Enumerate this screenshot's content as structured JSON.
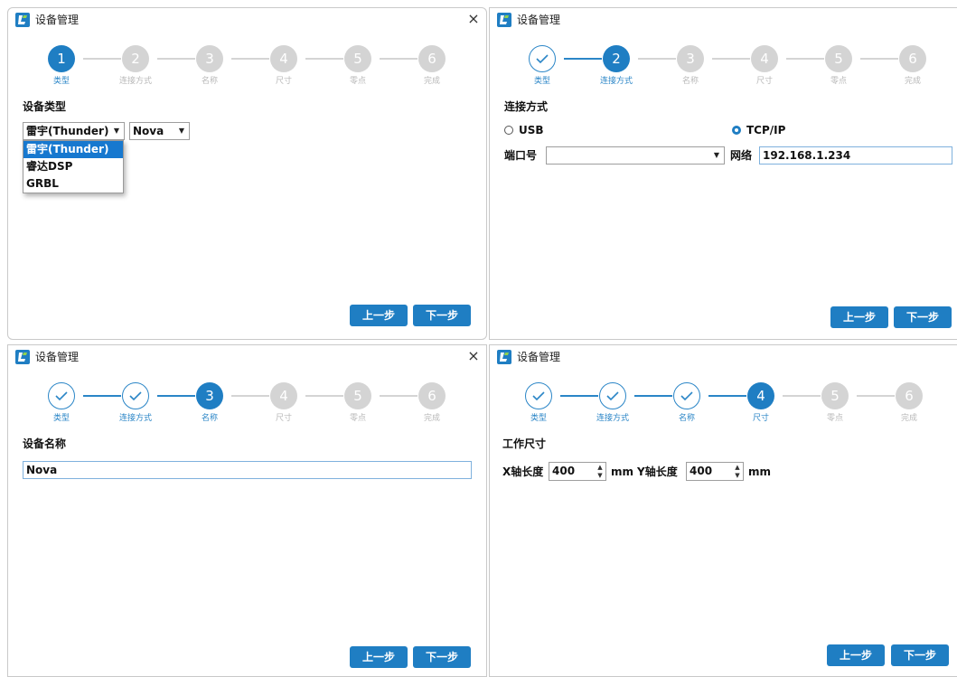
{
  "window": {
    "title": "设备管理",
    "close": "×",
    "app_icon": "app-logo-icon",
    "close_icon": "close-icon"
  },
  "steps": [
    {
      "num": "1",
      "label": "类型"
    },
    {
      "num": "2",
      "label": "连接方式"
    },
    {
      "num": "3",
      "label": "名称"
    },
    {
      "num": "4",
      "label": "尺寸"
    },
    {
      "num": "5",
      "label": "零点"
    },
    {
      "num": "6",
      "label": "完成"
    }
  ],
  "colors": {
    "accent": "#1f7ec3",
    "pending": "#d4d4d4",
    "selected_option": "#1778cf"
  },
  "buttons": {
    "prev": "上一步",
    "next": "下一步"
  },
  "panel1": {
    "current_step": 1,
    "section_title": "设备类型",
    "type_select": "雷宇(Thunder)",
    "model_select": "Nova",
    "options": [
      "雷宇(Thunder)",
      "睿达DSP",
      "GRBL"
    ]
  },
  "panel2": {
    "current_step": 2,
    "section_title": "连接方式",
    "usb_label": "USB",
    "tcp_label": "TCP/IP",
    "port_label": "端口号",
    "port_value": "",
    "net_label": "网络",
    "net_value": "192.168.1.234"
  },
  "panel3": {
    "current_step": 3,
    "section_title": "设备名称",
    "name_value": "Nova"
  },
  "panel4": {
    "current_step": 4,
    "section_title": "工作尺寸",
    "x_label": "X轴长度",
    "x_value": "400",
    "x_unit": "mm",
    "y_label": "Y轴长度",
    "y_value": "400",
    "y_unit": "mm"
  }
}
